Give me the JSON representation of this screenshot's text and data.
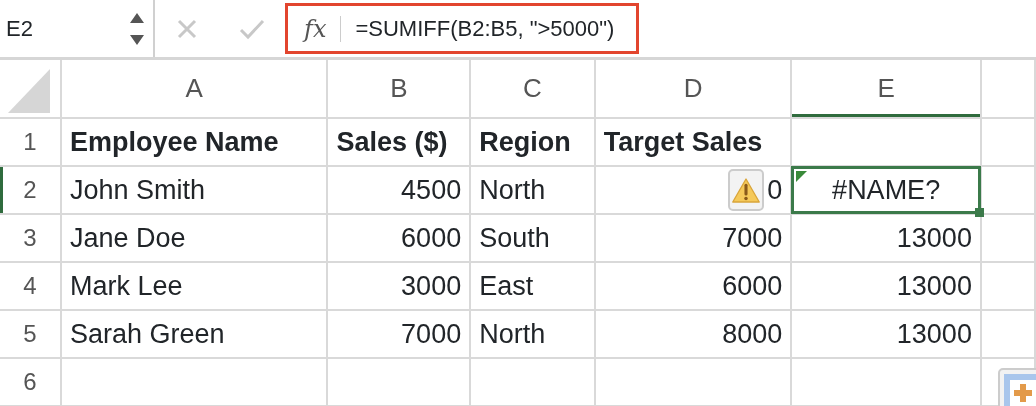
{
  "name_box": {
    "value": "E2"
  },
  "formula_bar": {
    "highlighted": true,
    "function_label": "fx",
    "formula": "=SUMIFF(B2:B5, \">5000\")"
  },
  "columns": [
    {
      "label": "A",
      "selected": false
    },
    {
      "label": "B",
      "selected": false
    },
    {
      "label": "C",
      "selected": false
    },
    {
      "label": "D",
      "selected": false
    },
    {
      "label": "E",
      "selected": true
    }
  ],
  "rows": [
    {
      "label": "1",
      "selected": false,
      "kind": "header",
      "cells": [
        {
          "text": "Employee Name",
          "kind": "text"
        },
        {
          "text": "Sales ($)",
          "kind": "text"
        },
        {
          "text": "Region",
          "kind": "text"
        },
        {
          "text": "Target Sales",
          "kind": "text"
        }
      ]
    },
    {
      "label": "2",
      "selected": true,
      "kind": "data",
      "cells": [
        {
          "text": "John Smith",
          "kind": "text"
        },
        {
          "text": "4500",
          "kind": "number"
        },
        {
          "text": "North",
          "kind": "text"
        },
        {
          "text": "0",
          "kind": "number",
          "warning": true
        },
        {
          "text": "#NAME?",
          "kind": "error"
        }
      ]
    },
    {
      "label": "3",
      "selected": false,
      "kind": "data",
      "cells": [
        {
          "text": "Jane Doe",
          "kind": "text"
        },
        {
          "text": "6000",
          "kind": "number"
        },
        {
          "text": "South",
          "kind": "text"
        },
        {
          "text": "7000",
          "kind": "number"
        },
        {
          "text": "13000",
          "kind": "number"
        }
      ]
    },
    {
      "label": "4",
      "selected": false,
      "kind": "data",
      "cells": [
        {
          "text": "Mark Lee",
          "kind": "text"
        },
        {
          "text": "3000",
          "kind": "number"
        },
        {
          "text": "East",
          "kind": "text"
        },
        {
          "text": "6000",
          "kind": "number"
        },
        {
          "text": "13000",
          "kind": "number"
        }
      ]
    },
    {
      "label": "5",
      "selected": false,
      "kind": "data",
      "cells": [
        {
          "text": "Sarah Green",
          "kind": "text"
        },
        {
          "text": "7000",
          "kind": "number"
        },
        {
          "text": "North",
          "kind": "text"
        },
        {
          "text": "8000",
          "kind": "number"
        },
        {
          "text": "13000",
          "kind": "number"
        }
      ]
    },
    {
      "label": "6",
      "selected": false,
      "kind": "data",
      "cells": []
    }
  ]
}
